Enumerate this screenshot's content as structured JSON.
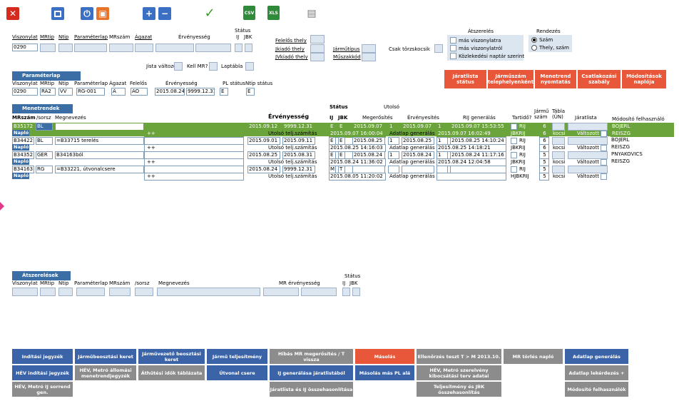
{
  "toolbar": {
    "icons": [
      "close-icon",
      "window-icon",
      "power-icon",
      "save-icon",
      "plus-icon",
      "minus-icon",
      "check-icon",
      "csv-icon",
      "xls-icon",
      "print-icon"
    ],
    "csv_label": "CSV",
    "xls_label": "XLS"
  },
  "filter": {
    "status_label": "Státus",
    "labels": {
      "viszonylat": "Viszonylat",
      "mrtip": "MRtip",
      "ntip": "Ntip",
      "parameterlap": "Paraméterlap",
      "mrszam": "MRszám",
      "agazat": "Ágazat",
      "ervenyesseg": "Érvényesség",
      "ij": "IJ",
      "jbk": "JBK"
    },
    "viszonylat_value": "0290",
    "felelos_thely": "Felelős thely",
    "jkiado_thely": "Jkiadó thely",
    "jvkiado_thely": "JVkiadó thely",
    "jarmutipus": "Járműtípus",
    "muszakkod": "Műszakkód",
    "csak_torzskocsik": "Csak törzskocsik",
    "jista_valtozott": "Jista változott",
    "kell_mr": "Kell MR?",
    "laptabla": "Laptábla",
    "atszereles_title": "Átszerelés",
    "atszereles_opts": [
      "más viszonylatra",
      "más viszonylatról",
      "Közlekedési naptár szerint"
    ],
    "rendezes_title": "Rendezés",
    "rendezes_opts": [
      "Szám",
      "Thely, szám"
    ]
  },
  "parameterlap": {
    "title": "Paraméterlap",
    "headers": [
      "Viszonylat",
      "MRtip",
      "Ntip",
      "Paraméterlap",
      "Ágazat",
      "Felelős",
      "Érvényesség",
      "PL státus",
      "Ntip státus"
    ],
    "values": {
      "viszonylat": "0290",
      "mrtip": "RA2",
      "ntip": "VV",
      "parameterlap": "RG-001",
      "agazat": "A",
      "felelos": "AO",
      "erv_from": "2015.08.24",
      "erv_to": "9999.12.31",
      "pl_status": "E",
      "ntip_status": "E"
    }
  },
  "actions": [
    {
      "label": "Járatlista státus"
    },
    {
      "label": "Járműszám telephelyenként"
    },
    {
      "label": "Menetrend nyomtatás"
    },
    {
      "label": "Csatlakozási szabály"
    },
    {
      "label": "Módosítások naplója"
    }
  ],
  "menetrendek": {
    "title": "Menetrendek",
    "headers": {
      "mrszam": "MRszám",
      "sorsz": "/sorsz",
      "megnevezes": "Megnevezés",
      "ervenyesseg": "Érvényesség",
      "status": "Státus",
      "ij": "IJ",
      "jbk": "JBK",
      "utolso": "Utolsó",
      "megerosites": "Megerősítés",
      "ervenyesites": "Érvényesítés",
      "rij": "RIJ generálás",
      "tartido": "Tartidő?",
      "jarmu_szam": "Jármű szám",
      "tabla": "Tábla (ÜN)",
      "jaratlista": "Járatlista",
      "modosito": "Módosító felhasználó"
    },
    "sub_labels": {
      "naplo": "Napló",
      "plusplus": "++",
      "utolso_telj": "Utolsó telj.számítás",
      "adatlap": "Adatlap generálás",
      "kocsi": "kocsi",
      "valtozott": "Változott"
    },
    "rows": [
      {
        "mrszam": "B35172",
        "sorsz": "BL",
        "megnevezes": "=B34422 vált mod",
        "erv_from": "2015.09.12",
        "erv_to": "9999.12.31",
        "ij": "E",
        "jbk": "E",
        "megerosites": "2015.09.07",
        "meg_n": "1",
        "ervenyesites": "2015.09.07",
        "erv_n": "1",
        "rij": "2015.09.07 15:53:55",
        "tartido": "RIJ",
        "jarmu": "6",
        "user1": "BOJERL",
        "user2": "REISZG",
        "telj": "2015.09.07 16:00:04",
        "adatlap": "2015.09.07 16:02:49",
        "tart2": "JBKRIJ",
        "jarmu2": "6",
        "highlight": true
      },
      {
        "mrszam": "B34422",
        "sorsz": "BL",
        "megnevezes": "=B33715 terelés",
        "erv_from": "2015.09.01",
        "erv_to": "2015.09.11",
        "ij": "E",
        "jbk": "E",
        "megerosites": "2015.08.25",
        "meg_n": "1",
        "ervenyesites": "2015.08.25",
        "erv_n": "1",
        "rij": "2015.08.25 14:10:24",
        "tartido": "RIJ",
        "jarmu": "6",
        "user1": "BOJERL",
        "user2": "REISZG",
        "telj": "2015.08.25 14:16:03",
        "adatlap": "2015.08.25 14:18:21",
        "tart2": "JBKRIJ",
        "jarmu2": "6",
        "highlight": false
      },
      {
        "mrszam": "B34352",
        "sorsz": "GER",
        "megnevezes": "B34163ból",
        "erv_from": "2015.08.25",
        "erv_to": "2015.08.31",
        "ij": "E",
        "jbk": "E",
        "megerosites": "2015.08.24",
        "meg_n": "1",
        "ervenyesites": "2015.08.24",
        "erv_n": "1",
        "rij": "2015.08.24 11:17:16",
        "tartido": "RIJ",
        "jarmu": "5",
        "user1": "PNYAKOVICS",
        "user2": "REISZG",
        "telj": "2015.08.24 11:36:02",
        "adatlap": "2015.08.24 12:04:58",
        "tart2": "JBKRIJ",
        "jarmu2": "5",
        "highlight": false
      },
      {
        "mrszam": "B34163",
        "sorsz": "RG",
        "megnevezes": "=B33221, útvonalcsere",
        "erv_from": "2015.08.24",
        "erv_to": "9999.12.31",
        "ij": "M",
        "jbk": "T",
        "megerosites": "",
        "meg_n": "",
        "ervenyesites": "",
        "erv_n": "",
        "rij": "",
        "tartido": "RIJ",
        "jarmu": "5",
        "user1": "",
        "user2": "",
        "telj": "2015.08.05 11:20:02",
        "adatlap": "",
        "tart2": "HJBKRIJ",
        "jarmu2": "5",
        "highlight": false
      }
    ]
  },
  "atszerelesek": {
    "title": "Átszerelések",
    "status_label": "Státus",
    "headers": [
      "Viszonylat",
      "MRtip",
      "Ntip",
      "Paraméterlap",
      "MRszám",
      "/sorsz",
      "Megnevezés",
      "MR érvényesség",
      "IJ",
      "JBK"
    ]
  },
  "bottom_buttons": [
    [
      {
        "label": "Indítási jegyzék",
        "kind": "blue"
      },
      {
        "label": "Járműbeosztási keret",
        "kind": "blue"
      },
      {
        "label": "Járművezető beosztási keret",
        "kind": "blue"
      },
      {
        "label": "Jármű teljesítmény",
        "kind": "blue"
      },
      {
        "label": "Hibás MR megerősítés / T vissza",
        "kind": "grey"
      },
      {
        "label": "Másolás",
        "kind": "red"
      },
      {
        "label": "Ellenőrzés teszt T > M 2013.10.",
        "kind": "grey"
      },
      {
        "label": "MR törlés napló",
        "kind": "grey"
      },
      {
        "label": "Adatlap generálás",
        "kind": "blue"
      }
    ],
    [
      {
        "label": "HÉV indítási jegyzék",
        "kind": "blue"
      },
      {
        "label": "HÉV, Metró állomási menetrendjegyzék",
        "kind": "grey"
      },
      {
        "label": "Áthűtési idők táblázata",
        "kind": "grey"
      },
      {
        "label": "Útvonal csere",
        "kind": "blue"
      },
      {
        "label": "IJ generálása járatlistából",
        "kind": "blue"
      },
      {
        "label": "Másolás más PL alá",
        "kind": "blue"
      },
      {
        "label": "HÉV, Metró szerelvény kibocsátási terv adatai",
        "kind": "grey"
      },
      {
        "label": "",
        "kind": "none"
      },
      {
        "label": "Adatlap lekérdezés +",
        "kind": "grey"
      }
    ],
    [
      {
        "label": "HÉV, Metró IJ sorrend gen.",
        "kind": "grey"
      },
      {
        "label": "",
        "kind": "none"
      },
      {
        "label": "",
        "kind": "none"
      },
      {
        "label": "",
        "kind": "none"
      },
      {
        "label": "Járatlista és IJ összehasonlítása",
        "kind": "grey"
      },
      {
        "label": "",
        "kind": "none"
      },
      {
        "label": "Teljesítmény és JBK összehasonlítás",
        "kind": "grey"
      },
      {
        "label": "",
        "kind": "none"
      },
      {
        "label": "Módosító felhasználók",
        "kind": "grey"
      }
    ]
  ]
}
